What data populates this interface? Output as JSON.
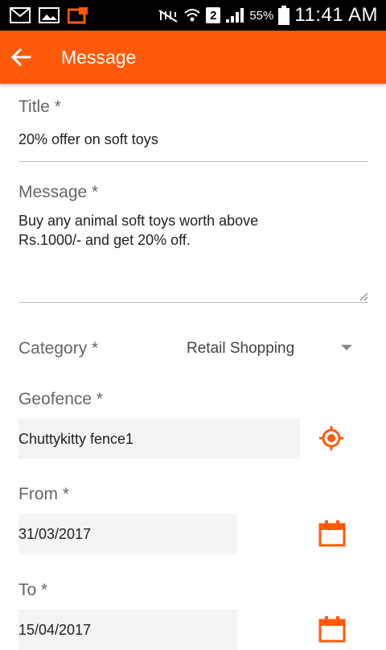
{
  "status_bar": {
    "sim_slot": "2",
    "battery": "55%",
    "time": "11:41 AM"
  },
  "app_bar": {
    "title": "Message"
  },
  "form": {
    "title": {
      "label": "Title *",
      "value": "20% offer on soft toys"
    },
    "message": {
      "label": "Message *",
      "value": "Buy any animal soft toys worth above\nRs.1000/- and get 20% off."
    },
    "category": {
      "label": "Category *",
      "selected": "Retail Shopping"
    },
    "geofence": {
      "label": "Geofence *",
      "value": "Chuttykitty fence1"
    },
    "from": {
      "label": "From *",
      "value": "31/03/2017"
    },
    "to": {
      "label": "To *",
      "value": "15/04/2017"
    }
  },
  "colors": {
    "accent": "#ff5a0a",
    "status_bar": "#000000"
  },
  "icons": {
    "back": "arrow-left-icon",
    "geofence": "target-location-icon",
    "date": "calendar-icon"
  }
}
